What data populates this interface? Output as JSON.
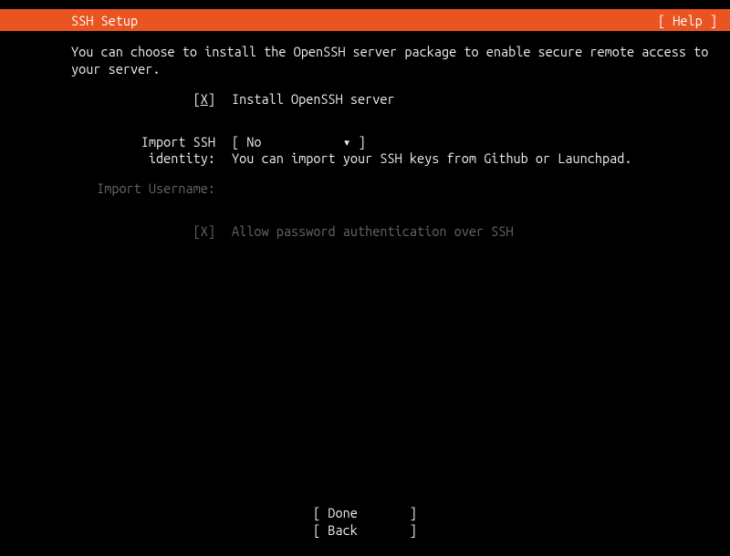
{
  "header": {
    "title": "SSH Setup",
    "help": "[ Help ]"
  },
  "intro": "You can choose to install the OpenSSH server package to enable secure remote access to your server.",
  "install": {
    "checkbox_prefix": "[",
    "checkbox_mark": "X",
    "checkbox_suffix": "]",
    "label": "Install OpenSSH server"
  },
  "identity": {
    "label": "Import SSH identity:",
    "dropdown": "[ No           ▾ ]",
    "hint": "You can import your SSH keys from Github or Launchpad."
  },
  "username": {
    "label": "Import Username:"
  },
  "allowpw": {
    "checkbox": "[X]",
    "label": "Allow password authentication over SSH"
  },
  "footer": {
    "done": "[ Done       ]",
    "back": "[ Back       ]"
  }
}
